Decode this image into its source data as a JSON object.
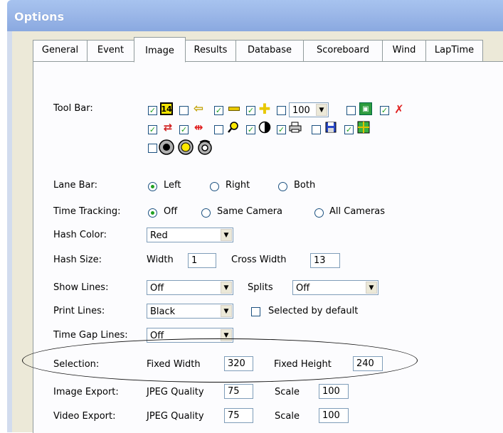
{
  "window": {
    "title": "Options"
  },
  "tabs": [
    {
      "label": "General",
      "active": false
    },
    {
      "label": "Event",
      "active": false
    },
    {
      "label": "Image",
      "active": true
    },
    {
      "label": "Results",
      "active": false
    },
    {
      "label": "Database",
      "active": false
    },
    {
      "label": "Scoreboard",
      "active": false
    },
    {
      "label": "Wind",
      "active": false
    },
    {
      "label": "LapTime",
      "active": false
    }
  ],
  "toolbar": {
    "label": "Tool Bar:",
    "check_glyph": "✓",
    "zoom_value": "100",
    "number_icon_text": "14",
    "items": [
      {
        "icon": "number-14-icon",
        "checked": true
      },
      {
        "icon": "left-arrow-icon",
        "checked": false
      },
      {
        "icon": "minus-icon",
        "checked": true
      },
      {
        "icon": "plus-icon",
        "checked": true
      },
      {
        "icon": "zoom-select",
        "checked": false
      },
      {
        "icon": "split-screen-icon",
        "checked": false
      },
      {
        "icon": "no-lanes-icon",
        "checked": true
      },
      {
        "icon": "text-align-icon",
        "checked": true
      },
      {
        "icon": "finish-lines-icon",
        "checked": true
      },
      {
        "icon": "magnifier-icon",
        "checked": false
      },
      {
        "icon": "contrast-icon",
        "checked": true
      },
      {
        "icon": "printer-icon",
        "checked": true
      },
      {
        "icon": "save-icon",
        "checked": false
      },
      {
        "icon": "grid-icon",
        "checked": true
      },
      {
        "icon": "camera-lens-icon",
        "checked": false
      }
    ]
  },
  "lane_bar": {
    "label": "Lane Bar:",
    "options": [
      "Left",
      "Right",
      "Both"
    ],
    "selected": "Left"
  },
  "time_tracking": {
    "label": "Time Tracking:",
    "options": [
      "Off",
      "Same Camera",
      "All Cameras"
    ],
    "selected": "Off"
  },
  "hash_color": {
    "label": "Hash Color:",
    "value": "Red"
  },
  "hash_size": {
    "label": "Hash Size:",
    "width_label": "Width",
    "width": "1",
    "cross_label": "Cross Width",
    "cross": "13"
  },
  "show_lines": {
    "label": "Show Lines:",
    "value": "Off",
    "splits_label": "Splits",
    "splits_value": "Off"
  },
  "print_lines": {
    "label": "Print Lines:",
    "value": "Black",
    "default_label": "Selected by default",
    "default_checked": false
  },
  "time_gap_lines": {
    "label": "Time Gap Lines:",
    "value": "Off"
  },
  "selection": {
    "label": "Selection:",
    "width_label": "Fixed Width",
    "width": "320",
    "height_label": "Fixed Height",
    "height": "240"
  },
  "image_export": {
    "label": "Image Export:",
    "quality_label": "JPEG Quality",
    "quality": "75",
    "scale_label": "Scale",
    "scale": "100"
  },
  "video_export": {
    "label": "Video Export:",
    "quality_label": "JPEG Quality",
    "quality": "75",
    "scale_label": "Scale",
    "scale": "100"
  }
}
